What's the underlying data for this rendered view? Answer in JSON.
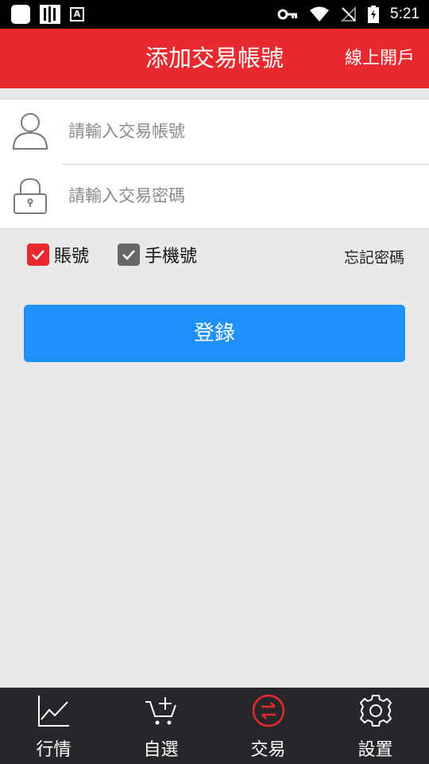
{
  "status_bar": {
    "time": "5:21"
  },
  "header": {
    "title": "添加交易帳號",
    "action_label": "線上開戶"
  },
  "form": {
    "account_placeholder": "請輸入交易帳號",
    "password_placeholder": "請輸入交易密碼"
  },
  "options": {
    "account_checkbox": {
      "label": "賬號",
      "checked": true,
      "color": "#e8292e"
    },
    "phone_checkbox": {
      "label": "手機號",
      "checked": true,
      "color": "#666666"
    },
    "forgot_label": "忘記密碼"
  },
  "login_label": "登錄",
  "colors": {
    "brand_red": "#e8292e",
    "login_blue": "#1e90ff",
    "tabbar_bg": "#27272b"
  },
  "tabs": [
    {
      "label": "行情",
      "icon": "line-chart-icon",
      "active": false
    },
    {
      "label": "自選",
      "icon": "cart-add-icon",
      "active": false
    },
    {
      "label": "交易",
      "icon": "exchange-icon",
      "active": true
    },
    {
      "label": "設置",
      "icon": "gear-icon",
      "active": false
    }
  ]
}
